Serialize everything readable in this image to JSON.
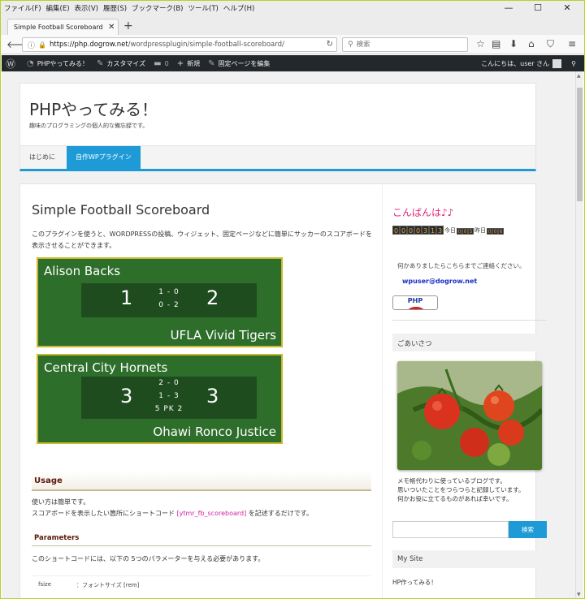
{
  "browser": {
    "menus": [
      "ファイル(F)",
      "編集(E)",
      "表示(V)",
      "履歴(S)",
      "ブックマーク(B)",
      "ツール(T)",
      "ヘルプ(H)"
    ],
    "window_controls": [
      "—",
      "☐",
      "✕"
    ],
    "tab_title": "Simple Football Scoreboard – PHP",
    "url_domain": "https://php.dogrow.net",
    "url_path": "/wordpressplugin/simple-football-scoreboard/",
    "search_placeholder": "検索"
  },
  "adminbar": {
    "site": "PHPやってみる！",
    "customize": "カスタマイズ",
    "comments": "0",
    "new": "新規",
    "edit": "固定ページを編集",
    "greeting": "こんにちは、user さん"
  },
  "site": {
    "title": "PHPやってみる！",
    "description": "趣味のプログラミングの個人的な備忘録です。"
  },
  "menu": [
    "はじめに",
    "自作WPプラグイン"
  ],
  "post": {
    "title": "Simple Football Scoreboard",
    "intro": "このプラグインを使うと、WORDPRESSの投稿、ウィジェット、固定ページなどに簡単にサッカーのスコアボードを表示させることができます。"
  },
  "scoreboards": [
    {
      "home": "Alison Backs",
      "away": "UFLA Vivid Tigers",
      "home_score": "1",
      "away_score": "2",
      "halves": [
        "1 - 0",
        "0 - 2"
      ]
    },
    {
      "home": "Central City Hornets",
      "away": "Ohawi Ronco Justice",
      "home_score": "3",
      "away_score": "3",
      "halves": [
        "2 - 0",
        "1 - 3",
        "5 PK 2"
      ]
    }
  ],
  "usage": {
    "heading": "Usage",
    "line1": "使い方は簡単です。",
    "line2_pre": "スコアボードを表示したい箇所にショートコード ",
    "code": "[ytmr_fb_scoreboard]",
    "line2_post": " を記述するだけです。"
  },
  "parameters": {
    "heading": "Parameters",
    "text": "このショートコードには、以下の 5つのパラメーターを与える必要があります。",
    "row_key": "fsize",
    "row_val": "：フォントサイズ [rem]"
  },
  "sidebar": {
    "greeting": "こんばんは♪♪",
    "counter_total": [
      "0",
      "0",
      "0",
      "0",
      "3",
      "1",
      "3"
    ],
    "today_label": "今日",
    "today": [
      "0",
      "0",
      "5"
    ],
    "yesterday_label": "昨日",
    "yesterday": [
      "0",
      "0",
      "6"
    ],
    "contact": "何かありましたらこちらまでご連絡ください。",
    "email": "wpuser@dogrow.net",
    "php_badge": "PHP",
    "aisatsu_title": "ごあいさつ",
    "aisatsu_text": [
      "メモ帳代わりに使っているブログです。",
      "思いついたことをつらつらと記録しています。",
      "何かお役に立てるものがあれば幸いです。"
    ],
    "search_button": "検索",
    "mysite_title": "My Site",
    "mysite_link": "HP作ってみる！"
  }
}
